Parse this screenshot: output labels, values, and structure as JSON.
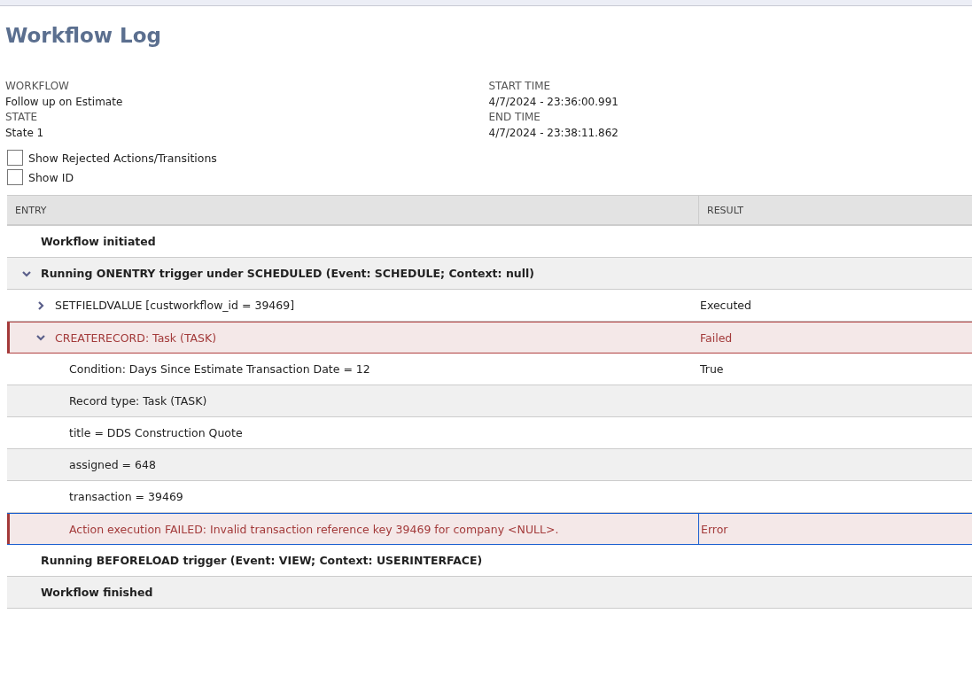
{
  "page_title": "Workflow Log",
  "details_left": [
    {
      "label": "WORKFLOW",
      "value": "Follow up on Estimate"
    },
    {
      "label": "STATE",
      "value": "State 1"
    }
  ],
  "details_right": [
    {
      "label": "START TIME",
      "value": "4/7/2024 - 23:36:00.991"
    },
    {
      "label": "END TIME",
      "value": "4/7/2024 - 23:38:11.862"
    }
  ],
  "options": [
    {
      "label": "Show Rejected Actions/Transitions",
      "checked": false
    },
    {
      "label": "Show ID",
      "checked": false
    }
  ],
  "table": {
    "columns": [
      "ENTRY",
      "RESULT"
    ],
    "rows": [
      {
        "entry": "Workflow initiated",
        "error": false,
        "selected": false
      },
      {
        "entry": "Running ONENTRY trigger under SCHEDULED (Event: SCHEDULE; Context: null)",
        "error": false,
        "selected": false,
        "expanded": true,
        "children": [
          {
            "entry": "SETFIELDVALUE [custworkflow_id = 39469]",
            "result": "Executed",
            "error": false,
            "selected": false,
            "expanded": false
          },
          {
            "entry": "CREATERECORD: Task (TASK)",
            "result": "Failed",
            "error": true,
            "selected": false,
            "expanded": true,
            "children": [
              {
                "entry": "Condition: Days Since Estimate Transaction Date = 12",
                "result": "True",
                "error": false,
                "selected": false
              },
              {
                "entry": "Record type: Task (TASK)",
                "error": false,
                "selected": false
              },
              {
                "entry": "title = DDS Construction Quote",
                "error": false,
                "selected": false
              },
              {
                "entry": "assigned = 648",
                "error": false,
                "selected": false
              },
              {
                "entry": "transaction = 39469",
                "error": false,
                "selected": false
              },
              {
                "entry": "Action execution FAILED: Invalid transaction reference key 39469 for company <NULL>.",
                "result": "Error",
                "error": true,
                "selected": true
              }
            ]
          }
        ]
      },
      {
        "entry": "Running BEFORELOAD trigger (Event: VIEW; Context: USERINTERFACE)",
        "error": false,
        "selected": false
      },
      {
        "entry": "Workflow finished",
        "error": false,
        "selected": false
      }
    ]
  }
}
